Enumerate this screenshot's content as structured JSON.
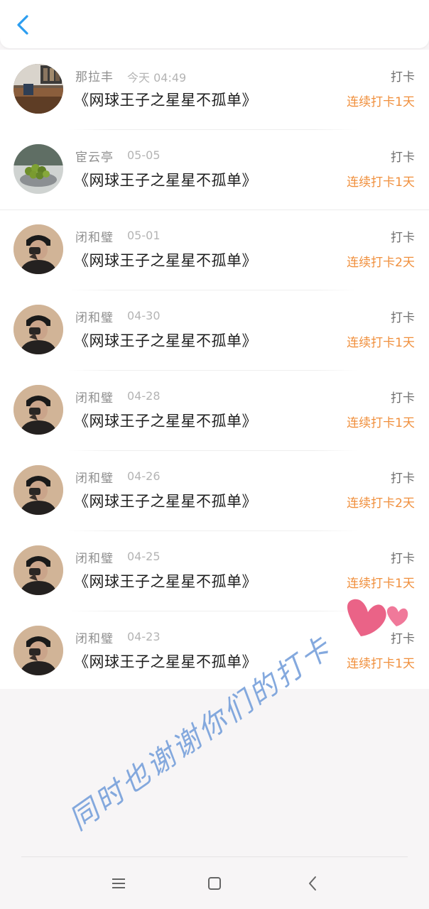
{
  "header": {
    "back_icon": "chevron-left-icon",
    "accent_color": "#2c9ef0"
  },
  "entries": [
    {
      "name": "那拉丰",
      "time": "今天 04:49",
      "title": "《网球王子之星星不孤单》",
      "action": "打卡",
      "streak": "连续打卡1天"
    },
    {
      "name": "宦云亭",
      "time": "05-05",
      "title": "《网球王子之星星不孤单》",
      "action": "打卡",
      "streak": "连续打卡1天"
    },
    {
      "name": "闭和璧",
      "time": "05-01",
      "title": "《网球王子之星星不孤单》",
      "action": "打卡",
      "streak": "连续打卡2天"
    },
    {
      "name": "闭和璧",
      "time": "04-30",
      "title": "《网球王子之星星不孤单》",
      "action": "打卡",
      "streak": "连续打卡1天"
    },
    {
      "name": "闭和璧",
      "time": "04-28",
      "title": "《网球王子之星星不孤单》",
      "action": "打卡",
      "streak": "连续打卡1天"
    },
    {
      "name": "闭和璧",
      "time": "04-26",
      "title": "《网球王子之星星不孤单》",
      "action": "打卡",
      "streak": "连续打卡2天"
    },
    {
      "name": "闭和璧",
      "time": "04-25",
      "title": "《网球王子之星星不孤单》",
      "action": "打卡",
      "streak": "连续打卡1天"
    },
    {
      "name": "闭和璧",
      "time": "04-23",
      "title": "《网球王子之星星不孤单》",
      "action": "打卡",
      "streak": "连续打卡1天"
    }
  ],
  "handwritten_note": "同时也谢谢你们的打卡",
  "navbar": {
    "menu_icon": "menu-icon",
    "home_icon": "home-square-icon",
    "back_icon": "back-triangle-icon"
  },
  "colors": {
    "streak": "#f08f3c",
    "heart": "#e8527a",
    "handwriting": "#6f9ad8"
  }
}
